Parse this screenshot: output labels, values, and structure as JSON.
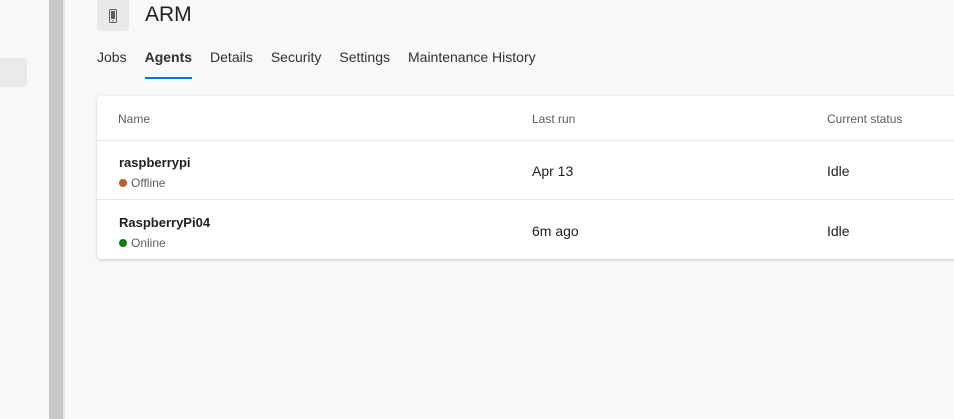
{
  "header": {
    "title": "ARM",
    "icon": "mobile-device-icon"
  },
  "tabs": [
    {
      "label": "Jobs",
      "active": false
    },
    {
      "label": "Agents",
      "active": true
    },
    {
      "label": "Details",
      "active": false
    },
    {
      "label": "Security",
      "active": false
    },
    {
      "label": "Settings",
      "active": false
    },
    {
      "label": "Maintenance History",
      "active": false
    }
  ],
  "table": {
    "columns": [
      "Name",
      "Last run",
      "Current status"
    ],
    "rows": [
      {
        "name": "raspberrypi",
        "state": "Offline",
        "state_color": "#b6612a",
        "last_run": "Apr 13",
        "status": "Idle"
      },
      {
        "name": "RaspberryPi04",
        "state": "Online",
        "state_color": "#107c10",
        "last_run": "6m ago",
        "status": "Idle"
      }
    ]
  },
  "colors": {
    "accent": "#0078d4"
  }
}
